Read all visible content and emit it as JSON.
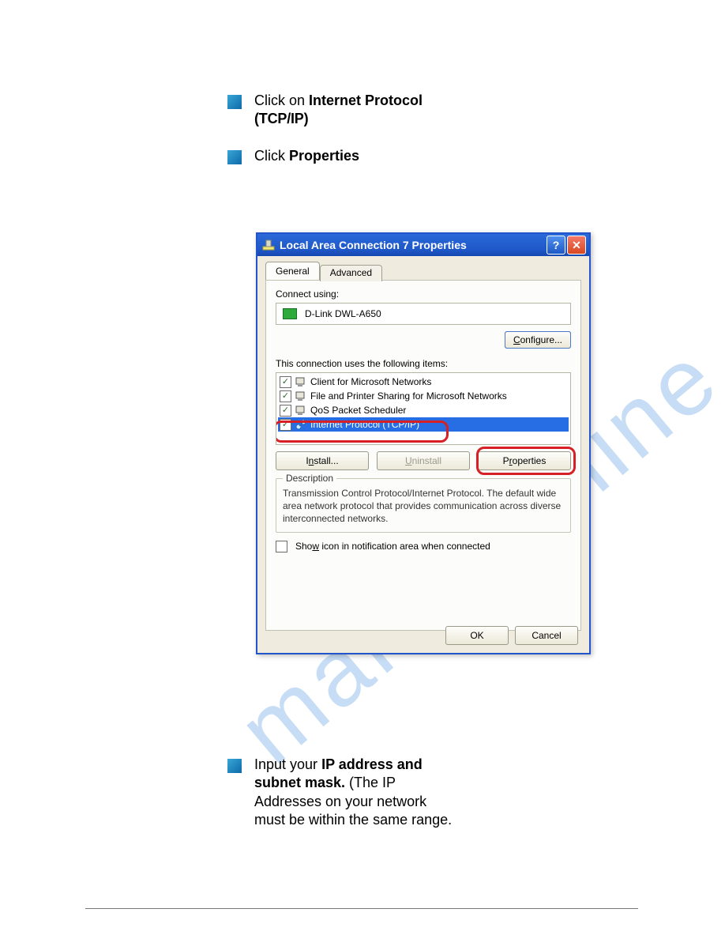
{
  "bullets": {
    "b1_prefix": "Click on ",
    "b1_bold_line1": "Internet Protocol",
    "b1_bold_line2": "(TCP/IP)",
    "b2_prefix": "Click ",
    "b2_bold": "Properties",
    "b3_prefix": "Input your ",
    "b3_bold": "IP address and subnet mask.",
    "b3_rest": " (The IP Addresses on your network must be within the same range."
  },
  "watermark": "manualshine.com",
  "dialog": {
    "title": "Local Area Connection 7 Properties",
    "tabs": {
      "general": "General",
      "advanced": "Advanced"
    },
    "connect_using_label": "Connect using:",
    "adapter": "D-Link DWL-A650",
    "configure_btn": "Configure...",
    "items_label": "This connection uses the following items:",
    "items": [
      {
        "label": "Client for Microsoft Networks",
        "checked": true
      },
      {
        "label": "File and Printer Sharing for Microsoft Networks",
        "checked": true
      },
      {
        "label": "QoS Packet Scheduler",
        "checked": true
      },
      {
        "label": "Internet Protocol (TCP/IP)",
        "checked": true,
        "selected": true
      }
    ],
    "install_btn": "Install...",
    "uninstall_btn": "Uninstall",
    "properties_btn": "Properties",
    "desc_legend": "Description",
    "desc_text": "Transmission Control Protocol/Internet Protocol. The default wide area network protocol that provides communication across diverse interconnected networks.",
    "showicon_label": "Show icon in notification area when connected",
    "ok": "OK",
    "cancel": "Cancel"
  }
}
